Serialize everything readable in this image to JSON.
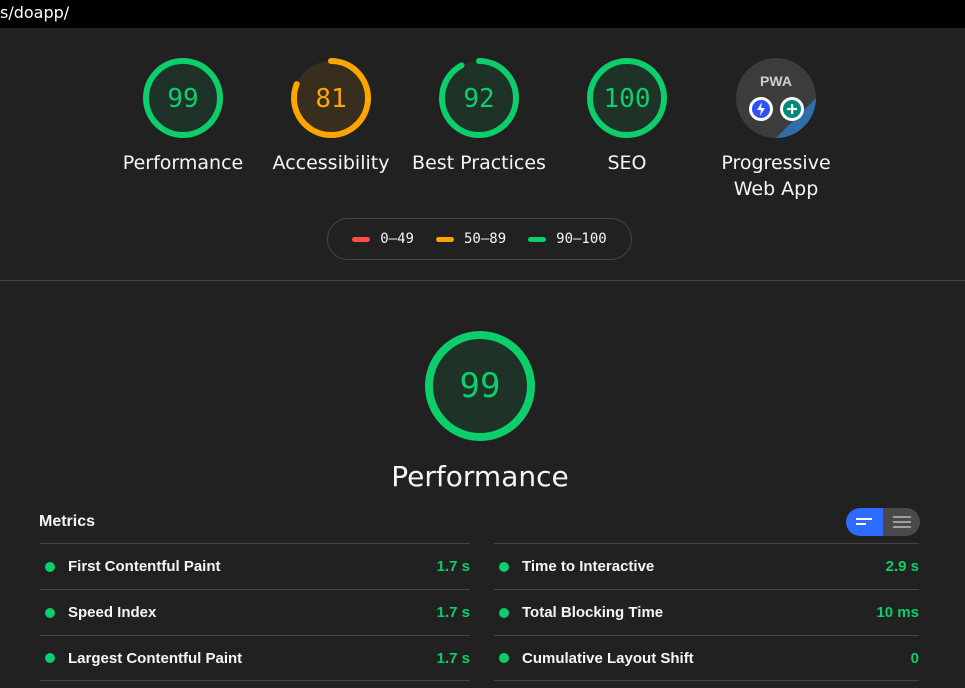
{
  "url": "s/doapp/",
  "colors": {
    "pass": "#0cce6b",
    "average": "#ffa400",
    "fail": "#ff4e42"
  },
  "categories": [
    {
      "label": "Performance",
      "score": 99,
      "rating": "pass"
    },
    {
      "label": "Accessibility",
      "score": 81,
      "rating": "average"
    },
    {
      "label": "Best Practices",
      "score": 92,
      "rating": "pass"
    },
    {
      "label": "SEO",
      "score": 100,
      "rating": "pass"
    }
  ],
  "pwa": {
    "badge_text": "PWA",
    "label_line1": "Progressive",
    "label_line2": "Web App"
  },
  "legend": [
    {
      "range": "0–49",
      "rating": "fail"
    },
    {
      "range": "50–89",
      "rating": "average"
    },
    {
      "range": "90–100",
      "rating": "pass"
    }
  ],
  "main": {
    "score": 99,
    "title": "Performance"
  },
  "metrics": {
    "title": "Metrics",
    "left": [
      {
        "name": "First Contentful Paint",
        "value": "1.7 s"
      },
      {
        "name": "Speed Index",
        "value": "1.7 s"
      },
      {
        "name": "Largest Contentful Paint",
        "value": "1.7 s"
      }
    ],
    "right": [
      {
        "name": "Time to Interactive",
        "value": "2.9 s"
      },
      {
        "name": "Total Blocking Time",
        "value": "10 ms"
      },
      {
        "name": "Cumulative Layout Shift",
        "value": "0"
      }
    ]
  }
}
